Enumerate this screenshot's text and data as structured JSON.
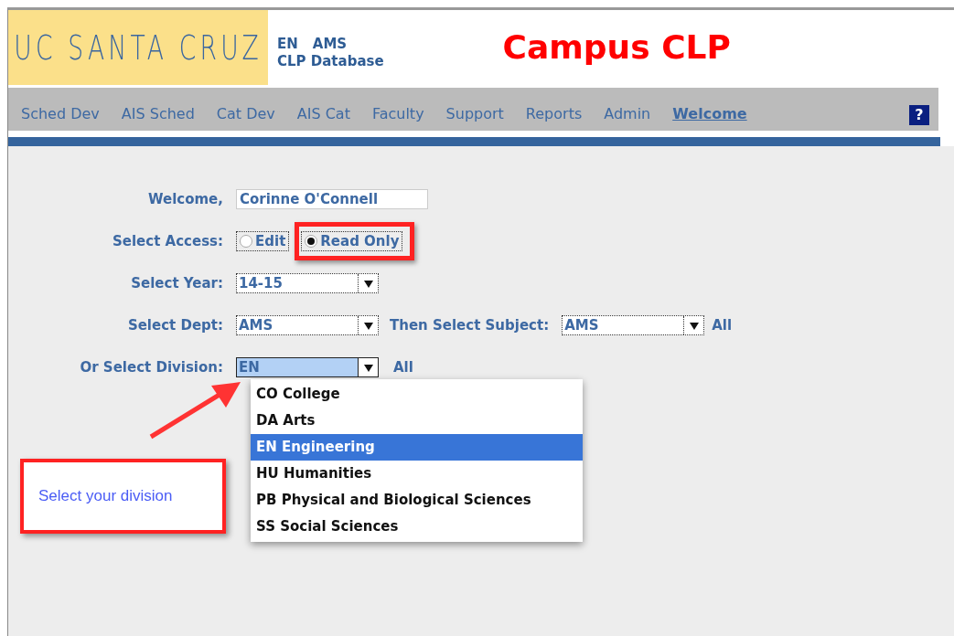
{
  "header": {
    "logo": "UC SANTA CRUZ",
    "division_code": "EN",
    "dept_code": "AMS",
    "subtitle": "CLP Database",
    "title": "Campus CLP"
  },
  "nav": {
    "items": [
      {
        "label": "Sched Dev",
        "selected": false
      },
      {
        "label": "AIS Sched",
        "selected": false
      },
      {
        "label": "Cat Dev",
        "selected": false
      },
      {
        "label": "AIS Cat",
        "selected": false
      },
      {
        "label": "Faculty",
        "selected": false
      },
      {
        "label": "Support",
        "selected": false
      },
      {
        "label": "Reports",
        "selected": false
      },
      {
        "label": "Admin",
        "selected": false
      },
      {
        "label": "Welcome",
        "selected": true
      }
    ],
    "help": "?"
  },
  "form": {
    "welcome_label": "Welcome,",
    "user_name": "Corinne O'Connell",
    "access_label": "Select Access:",
    "access_options": [
      {
        "label": "Edit",
        "selected": false
      },
      {
        "label": "Read Only",
        "selected": true
      }
    ],
    "year_label": "Select Year:",
    "year": "14-15",
    "dept_label": "Select Dept:",
    "dept": "AMS",
    "subject_label": "Then Select Subject:",
    "subject": "AMS",
    "subject_all": "All",
    "division_label": "Or Select Division:",
    "division": "EN",
    "division_all": "All",
    "division_options": [
      {
        "label": "CO College",
        "selected": false
      },
      {
        "label": "DA Arts",
        "selected": false
      },
      {
        "label": "EN Engineering",
        "selected": true
      },
      {
        "label": "HU Humanities",
        "selected": false
      },
      {
        "label": "PB Physical and Biological Sciences",
        "selected": false
      },
      {
        "label": "SS Social Sciences",
        "selected": false
      }
    ]
  },
  "callout": "Select your division"
}
